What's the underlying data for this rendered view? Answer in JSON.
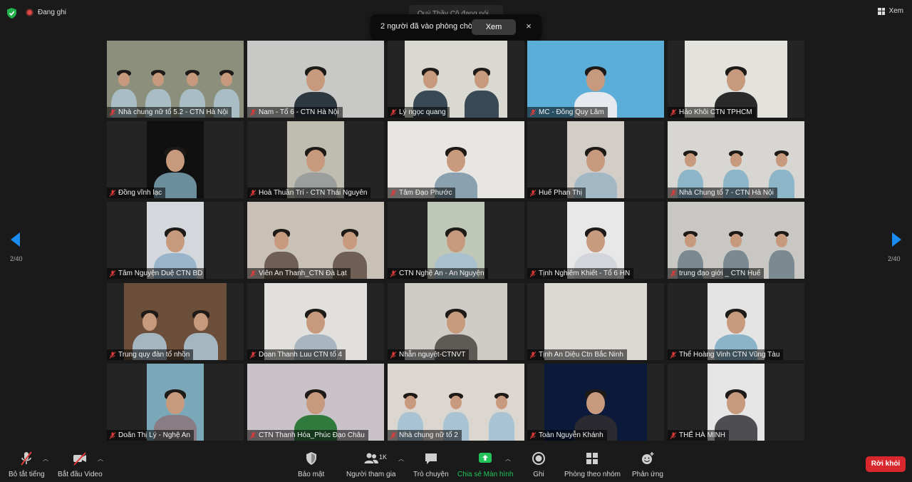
{
  "top": {
    "recording_label": "Đang ghi",
    "view_label": "Xem",
    "speaking_text": "Quý Thầy Cô đang nói..."
  },
  "notice": {
    "text": "2 người đã vào phòng chờ",
    "button": "Xem",
    "close": "×"
  },
  "pager": {
    "left": "2/40",
    "right": "2/40"
  },
  "participants": [
    "Nhà chung nữ tổ 5.2 - CTN Hà Nội",
    "Nam - Tổ 6 - CTN Hà Nội",
    "Lý ngọc quang",
    "MC - Đông Quy Lâm",
    "Hảo Khôi CTN TPHCM",
    "Đồng vĩnh lạc",
    "Hoà Thuần Trí - CTN Thái Nguyên",
    "Tâm Đạo Phước",
    "Huế Phan Thị",
    "Nhà Chung tổ 7 - CTN Hà Nội",
    "Tâm Nguyện Duệ CTN BD",
    "Viên An Thanh_CTN Đà Lạt",
    "CTN Nghệ An - An Nguyện",
    "Tịnh Nghiêm Khiết - Tổ 6 HN",
    "trung đạo giới _ CTN Huế",
    "Trung quy đàn tổ nhồn",
    "Doan Thanh Luu CTN tổ 4",
    "Nhẫn nguyệt-CTNVT",
    "Tịnh An Diệu Ctn Bắc Ninh",
    "Thể Hoàng Vinh CTN Vũng Tàu",
    "Doãn Thị Lý - Nghệ An",
    "CTN Thanh Hóa_Phúc Đạo Châu",
    "Nhà chung nữ tổ 2",
    "Toàn Nguyễn Khánh",
    "THỂ HÀ MINH"
  ],
  "toolbar": {
    "mute": "Bỏ tắt tiếng",
    "video": "Bắt đầu Video",
    "security": "Bảo mật",
    "participants": "Người tham gia",
    "participants_count": "1K",
    "chat": "Trò chuyện",
    "share": "Chia sẻ Màn hình",
    "record": "Ghi",
    "breakout": "Phòng theo nhóm",
    "reactions": "Phản ứng",
    "leave": "Rời khỏi"
  },
  "colors": {
    "accent": "#1a8cf0",
    "share_green": "#22c35a",
    "leave_red": "#d9272e"
  }
}
